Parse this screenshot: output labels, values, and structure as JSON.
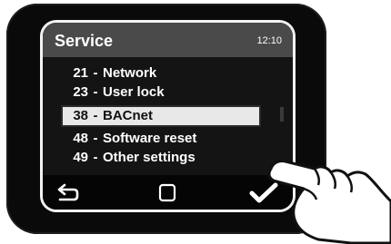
{
  "header": {
    "title": "Service",
    "time": "12:10"
  },
  "menu": {
    "items": [
      {
        "code": "21",
        "label": "Network",
        "selected": false
      },
      {
        "code": "23",
        "label": "User lock",
        "selected": false
      },
      {
        "code": "38",
        "label": "BACnet",
        "selected": true
      },
      {
        "code": "48",
        "label": "Software reset",
        "selected": false
      },
      {
        "code": "49",
        "label": "Other settings",
        "selected": false
      }
    ]
  },
  "footer": {
    "back_icon": "back-arrow-icon",
    "home_icon": "square-icon",
    "confirm_icon": "checkmark-icon"
  },
  "colors": {
    "header_bg": "#4a4a4a",
    "selected_bg": "#e8e8e8",
    "text": "#ffffff"
  }
}
